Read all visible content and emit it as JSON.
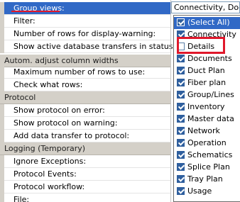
{
  "grid": {
    "rows": [
      {
        "label": "Group views:",
        "selected": true
      },
      {
        "label": "Filter:"
      },
      {
        "label": "Number of rows for display-warning:"
      },
      {
        "label": "Show active database transfers in status bar"
      }
    ],
    "categories": [
      {
        "title": "Autom. adjust column widths",
        "rows": [
          "Maximum number of rows to use:",
          "Check what rows:"
        ]
      },
      {
        "title": "Protocol",
        "rows": [
          "Show protocol on error:",
          "Show protocol on warning:",
          "Add data transfer to protocol:"
        ]
      },
      {
        "title": "Logging (Temporary)",
        "rows": [
          "Ignore Exceptions:",
          "Protocol Events:",
          "Protocol workflow:",
          "File:"
        ]
      }
    ]
  },
  "group_views_value": "Connectivity, Documents",
  "dropdown": {
    "options": [
      {
        "label": "(Select All)",
        "checked": true,
        "highlighted": true
      },
      {
        "label": "Connectivity",
        "checked": true
      },
      {
        "label": "Details",
        "checked": false
      },
      {
        "label": "Documents",
        "checked": true
      },
      {
        "label": "Duct Plan",
        "checked": true
      },
      {
        "label": "Fiber plan",
        "checked": true
      },
      {
        "label": "Group/Lines",
        "checked": true
      },
      {
        "label": "Inventory",
        "checked": true
      },
      {
        "label": "Master data",
        "checked": true
      },
      {
        "label": "Network",
        "checked": true
      },
      {
        "label": "Operation",
        "checked": true
      },
      {
        "label": "Schematics",
        "checked": true
      },
      {
        "label": "Splice Plan",
        "checked": true
      },
      {
        "label": "Tray Plan",
        "checked": true
      },
      {
        "label": "Usage",
        "checked": true
      }
    ]
  },
  "colors": {
    "selection": "#3169c6",
    "annotation": "#e0182b",
    "category_bg": "#d4d0c8"
  }
}
